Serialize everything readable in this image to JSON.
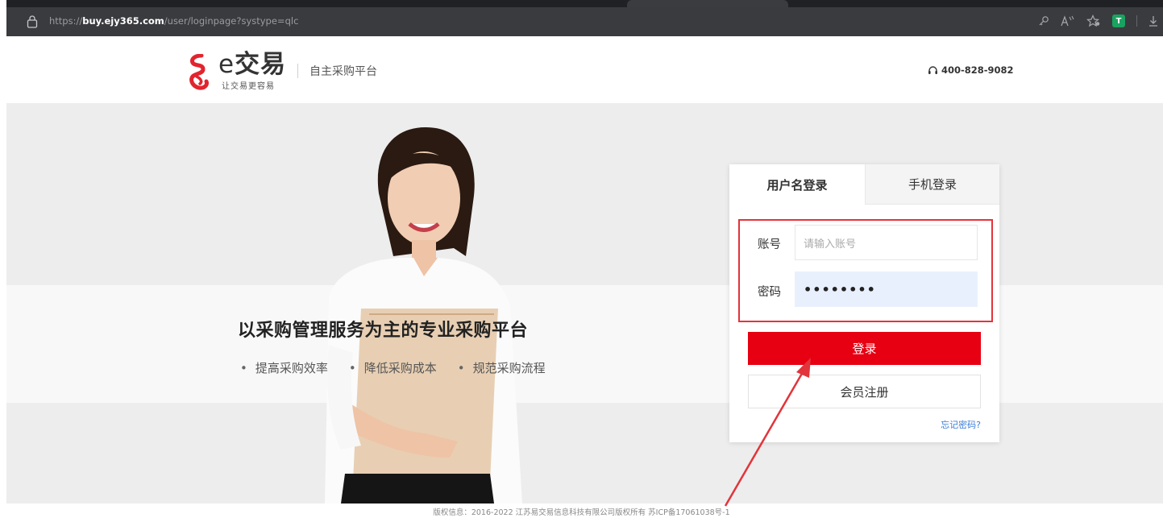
{
  "browser": {
    "url_prefix": "https://",
    "url_domain": "buy.ejy365.com",
    "url_path": "/user/loginpage?systype=qlc",
    "icons": [
      "key-icon",
      "read-aloud-icon",
      "favorite-icon",
      "extension-t-icon",
      "download-icon"
    ],
    "extension_letter": "T"
  },
  "header": {
    "logo_letter": "e",
    "logo_text": "交易",
    "logo_slogan": "让交易更容易",
    "platform_name": "自主采购平台",
    "hotline": "400-828-9082"
  },
  "hero": {
    "slogan": "以采购管理服务为主的专业采购平台",
    "bullets": [
      "提高采购效率",
      "降低采购成本",
      "规范采购流程"
    ]
  },
  "login": {
    "tabs": [
      {
        "label": "用户名登录",
        "active": true
      },
      {
        "label": "手机登录",
        "active": false
      }
    ],
    "account_label": "账号",
    "account_placeholder": "请输入账号",
    "password_label": "密码",
    "password_value": "••••••••",
    "login_button": "登录",
    "register_button": "会员注册",
    "forgot_link": "忘记密码?"
  },
  "colors": {
    "brand_red": "#e60012",
    "annotation_red": "#e2343b",
    "link_blue": "#3c7dd6"
  },
  "footer": {
    "text": "版权信息：2016-2022 江苏易交易信息科技有限公司版权所有 苏ICP备17061038号-1"
  }
}
